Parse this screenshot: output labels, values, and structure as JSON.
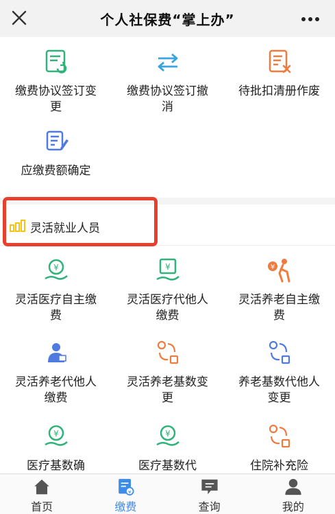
{
  "header": {
    "title": "个人社保费“掌上办”"
  },
  "top_grid": [
    {
      "label": "缴费协议签订变更",
      "icon": "document-refresh-icon"
    },
    {
      "label": "缴费协议签订撤消",
      "icon": "swap-arrows-icon"
    },
    {
      "label": "待批扣清册作废",
      "icon": "document-cancel-icon"
    },
    {
      "label": "应缴费额确定",
      "icon": "document-edit-icon"
    }
  ],
  "section": {
    "title": "灵活就业人员"
  },
  "flex_grid": [
    {
      "label": "灵活医疗自主缴费",
      "icon": "yuan-hand-icon"
    },
    {
      "label": "灵活医疗代他人缴费",
      "icon": "yuan-screen-hand-icon"
    },
    {
      "label": "灵活养老自主缴费",
      "icon": "elderly-yuan-icon"
    },
    {
      "label": "灵活养老代他人缴费",
      "icon": "person-id-icon"
    },
    {
      "label": "灵活养老基数变更",
      "icon": "exchange-icon"
    },
    {
      "label": "养老基数代他人变更",
      "icon": "exchange-icon"
    },
    {
      "label": "医疗基数确",
      "icon": "yuan-hand-icon"
    },
    {
      "label": "医疗基数代",
      "icon": "yuan-hand-icon"
    },
    {
      "label": "住院补充险",
      "icon": "exchange-icon"
    }
  ],
  "tabbar": {
    "items": [
      {
        "label": "首页",
        "icon": "home-icon"
      },
      {
        "label": "缴费",
        "icon": "payment-icon"
      },
      {
        "label": "查询",
        "icon": "message-icon"
      },
      {
        "label": "我的",
        "icon": "user-icon"
      }
    ]
  },
  "colors": {
    "accent": "#3d8ce8",
    "highlight": "#e8402f",
    "green": "#2fb37a",
    "orange": "#f07b3f",
    "yellow": "#f4c21b"
  }
}
